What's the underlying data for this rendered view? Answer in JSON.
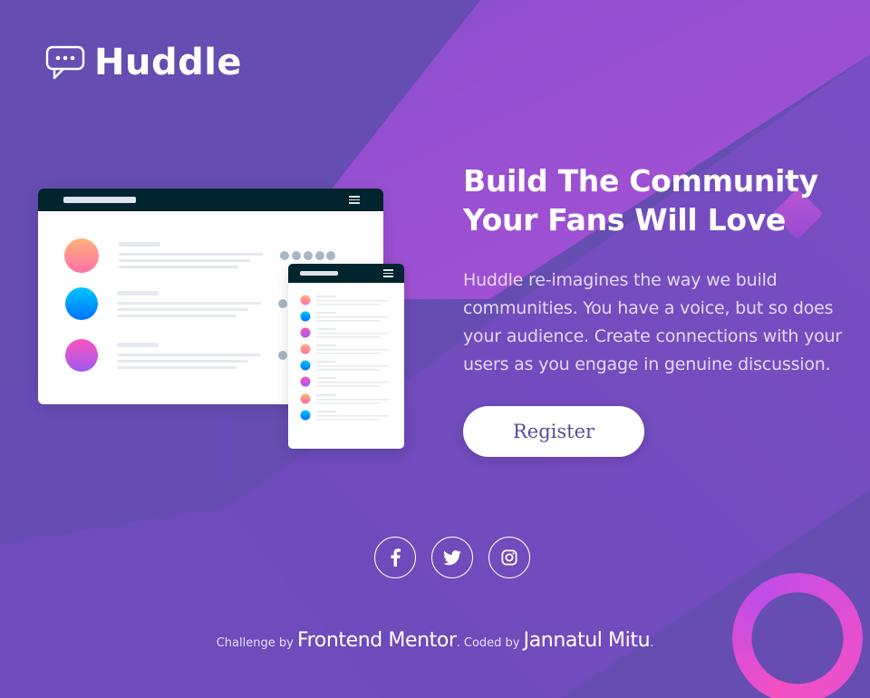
{
  "brand": {
    "name": "Huddle"
  },
  "hero": {
    "headline_line1": "Build The Community",
    "headline_line2": "Your Fans Will Love",
    "description": "Huddle re-imagines the way we build communities. You have a voice, but so does your audience. Create connections with your users as you engage in genuine discussion.",
    "cta_label": "Register"
  },
  "social": [
    {
      "name": "facebook",
      "icon": "facebook-icon"
    },
    {
      "name": "twitter",
      "icon": "twitter-icon"
    },
    {
      "name": "instagram",
      "icon": "instagram-icon"
    }
  ],
  "footer": {
    "prefix": "Challenge by ",
    "mentor_link": "Frontend Mentor",
    "middle": ". Coded by ",
    "author_link": "Jannatul Mitu",
    "suffix": "."
  },
  "colors": {
    "background": "#6b4fb4",
    "bar": "#00252e",
    "button_text": "#5a4a9b",
    "avatar_orange": "#ff9a8b",
    "avatar_blue": "#00a2ff",
    "avatar_pink": "#e44fd0"
  }
}
